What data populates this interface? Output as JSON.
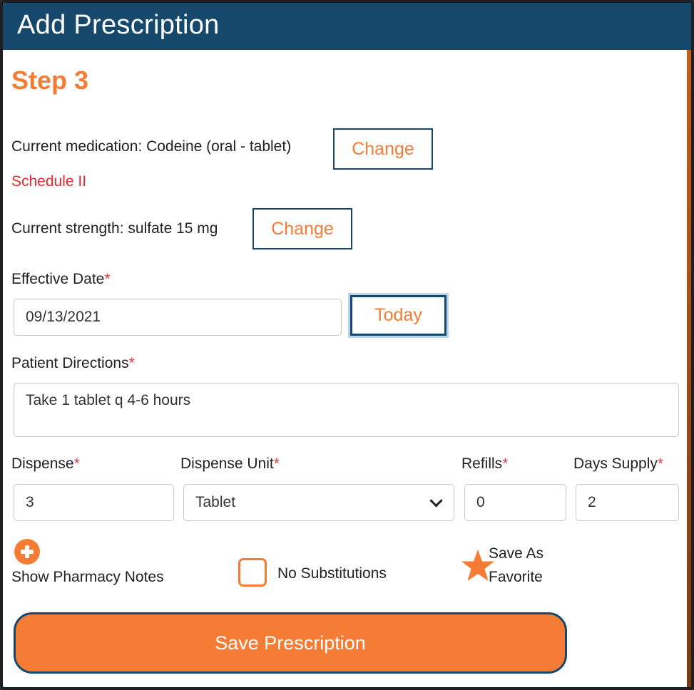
{
  "header": {
    "title": "Add Prescription"
  },
  "step_title": "Step 3",
  "medication": {
    "label": "Current medication: Codeine (oral - tablet)",
    "change_label": "Change",
    "schedule": "Schedule II"
  },
  "strength": {
    "label": "Current strength: sulfate 15 mg",
    "change_label": "Change"
  },
  "effective_date": {
    "label": "Effective Date",
    "required": "*",
    "value": "09/13/2021",
    "today_label": "Today"
  },
  "patient_directions": {
    "label": "Patient Directions",
    "required": "*",
    "value": "Take 1 tablet q 4-6 hours"
  },
  "dispense": {
    "label": "Dispense",
    "required": "*",
    "value": "3"
  },
  "dispense_unit": {
    "label": "Dispense Unit",
    "required": "*",
    "value": "Tablet"
  },
  "refills": {
    "label": "Refills",
    "required": "*",
    "value": "0"
  },
  "days_supply": {
    "label": "Days Supply",
    "required": "*",
    "value": "2"
  },
  "pharmacy_notes_label": "Show Pharmacy Notes",
  "no_substitutions_label": "No Substitutions",
  "favorite": {
    "line1": "Save As",
    "line2": "Favorite"
  },
  "save_button_label": "Save Prescription",
  "icons": {
    "add": "plus-circle-icon",
    "favorite": "star-icon",
    "dropdown": "chevron-down-icon"
  },
  "colors": {
    "header": "#16486c",
    "accent": "#f47c35",
    "schedule": "#e8272f"
  }
}
